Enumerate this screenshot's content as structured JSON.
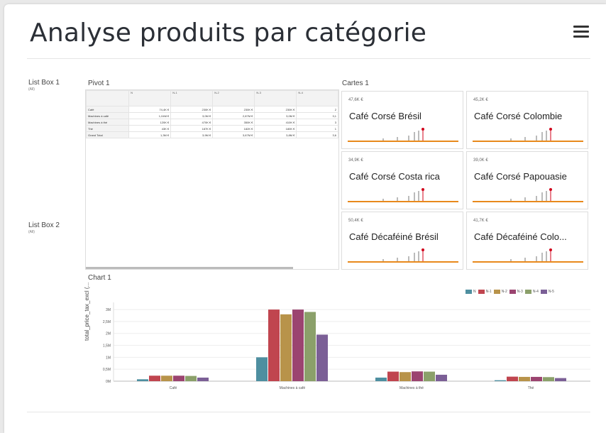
{
  "header": {
    "title": "Analyse produits par catégorie"
  },
  "list_box_1": {
    "label": "List Box 1",
    "sub": "(All)"
  },
  "list_box_2": {
    "label": "List Box 2",
    "sub": "(All)"
  },
  "pivot": {
    "label": "Pivot 1",
    "columns": [
      "N",
      "N-1",
      "N-2",
      "N-3",
      "N-4"
    ],
    "rows": [
      {
        "label": "Café",
        "values": [
          "74,4K €",
          "230K €",
          "230K €",
          "230K €",
          "2"
        ]
      },
      {
        "label": "Machines à café",
        "values": [
          "1,04M €",
          "3,0M €",
          "2,87M €",
          "3,0M €",
          "3,1"
        ]
      },
      {
        "label": "Machines à thé",
        "values": [
          "120K €",
          "470K €",
          "350K €",
          "410K €",
          "3"
        ]
      },
      {
        "label": "Thé",
        "values": [
          "43K €",
          "187K €",
          "182K €",
          "180K €",
          "1"
        ]
      },
      {
        "label": "Grand Total",
        "values": [
          "1,3M €",
          "3,9M €",
          "3,67M €",
          "3,8M €",
          "3,6"
        ]
      }
    ]
  },
  "cartes": {
    "label": "Cartes 1",
    "items": [
      {
        "value": "47,6K €",
        "name": "Café Corsé Brésil"
      },
      {
        "value": "45,2K €",
        "name": "Café Corsé Colombie"
      },
      {
        "value": "34,9K €",
        "name": "Café Corsé Costa rica"
      },
      {
        "value": "39,0K €",
        "name": "Café Corsé Papouasie"
      },
      {
        "value": "50,4K €",
        "name": "Café Décaféiné Brésil"
      },
      {
        "value": "41,7K €",
        "name": "Café Décaféiné Colo..."
      }
    ],
    "accent": "#e8891c",
    "marker": "#d0021b"
  },
  "chart_data": {
    "type": "bar",
    "title": "Chart 1",
    "ylabel": "total_price_tax_excl (...",
    "categories": [
      "Café",
      "Machines à café",
      "Machines à thé",
      "Thé"
    ],
    "yticks": [
      "0M",
      "0,5M",
      "1M",
      "1,5M",
      "2M",
      "2,5M",
      "3M"
    ],
    "ylim": [
      0,
      3.3
    ],
    "series": [
      {
        "name": "N",
        "color": "#4e8fa0",
        "values": [
          0.08,
          1.0,
          0.15,
          0.04
        ]
      },
      {
        "name": "N-1",
        "color": "#c0454f",
        "values": [
          0.23,
          3.0,
          0.4,
          0.19
        ]
      },
      {
        "name": "N-2",
        "color": "#b8934a",
        "values": [
          0.23,
          2.8,
          0.38,
          0.18
        ]
      },
      {
        "name": "N-3",
        "color": "#9b4470",
        "values": [
          0.23,
          3.0,
          0.41,
          0.18
        ]
      },
      {
        "name": "N-4",
        "color": "#8ba06a",
        "values": [
          0.22,
          2.9,
          0.4,
          0.17
        ]
      },
      {
        "name": "N-5",
        "color": "#7b5f96",
        "values": [
          0.15,
          1.95,
          0.27,
          0.13
        ]
      }
    ],
    "legend_position": "top-right",
    "grid": true
  }
}
